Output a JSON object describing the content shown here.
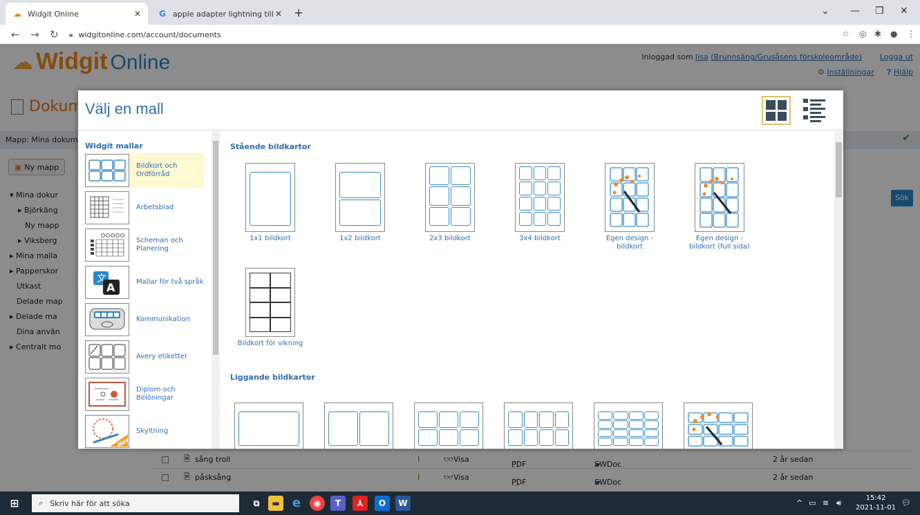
{
  "browser": {
    "tabs": [
      {
        "title": "Widgit Online",
        "icon": "widgit-favicon"
      },
      {
        "title": "apple adapter lightning till vga -",
        "icon": "google-favicon"
      }
    ],
    "url": "widgitonline.com/account/documents"
  },
  "site": {
    "logo_main": "Widgit",
    "logo_sub": "Online",
    "logged_in_prefix": "Inloggad som",
    "user": "lisa",
    "org": "(Brunnsäng/Grusåsens förskoleområde)",
    "logout": "Logga ut",
    "settings": "Inställningar",
    "help": "Hjälp",
    "doc_title": "Dokum",
    "folder_path": "Mapp: Mina dokum",
    "new_folder": "Ny mapp",
    "search_button": "Sök"
  },
  "tree": [
    "▾ Mina dokur",
    "▸ Björkäng",
    "Ny mapp",
    "▸ Viksberg",
    "▸ Mina malla",
    "▸ Papperskor",
    "Utkast",
    "Delade map",
    "▸ Delade ma",
    "Dina använ",
    "▸ Centralt mo"
  ],
  "doc_rows": [
    {
      "name": "sång troll",
      "view": "Visa",
      "pdf": "PDF",
      "swdoc": "SWDoc",
      "age": "2 år sedan"
    },
    {
      "name": "påsksång",
      "view": "Visa",
      "pdf": "PDF",
      "swdoc": "SWDoc",
      "age": "2 år sedan"
    }
  ],
  "modal": {
    "title": "Välj en mall",
    "sidebar_heading": "Widgit mallar",
    "categories": [
      {
        "label": "Bildkort och Ordförråd",
        "selected": true
      },
      {
        "label": "Arbetsblad"
      },
      {
        "label": "Scheman och Planering"
      },
      {
        "label": "Mallar för två språk"
      },
      {
        "label": "Kommunikation"
      },
      {
        "label": "Avery etiketter"
      },
      {
        "label": "Diplom och Belöningar"
      },
      {
        "label": "Skyltning"
      }
    ],
    "section_portrait": "Stående bildkartor",
    "portrait_cards": [
      {
        "label": "1x1 bildkort"
      },
      {
        "label": "1x2 bildkort"
      },
      {
        "label": "2x3 bildkort"
      },
      {
        "label": "3x4 bildkort"
      },
      {
        "label": "Egen design - bildkort"
      },
      {
        "label": "Egen design - bildkort (full sida)"
      },
      {
        "label": "Bildkort för vikning"
      }
    ],
    "section_landscape": "Liggande bildkartor"
  },
  "taskbar": {
    "search_placeholder": "Skriv här för att söka",
    "time": "15:42",
    "date": "2021-11-01"
  },
  "colors": {
    "accent_blue": "#2b6fb3",
    "brand_orange": "#f18a1b",
    "taskbar": "#1e2a35"
  }
}
